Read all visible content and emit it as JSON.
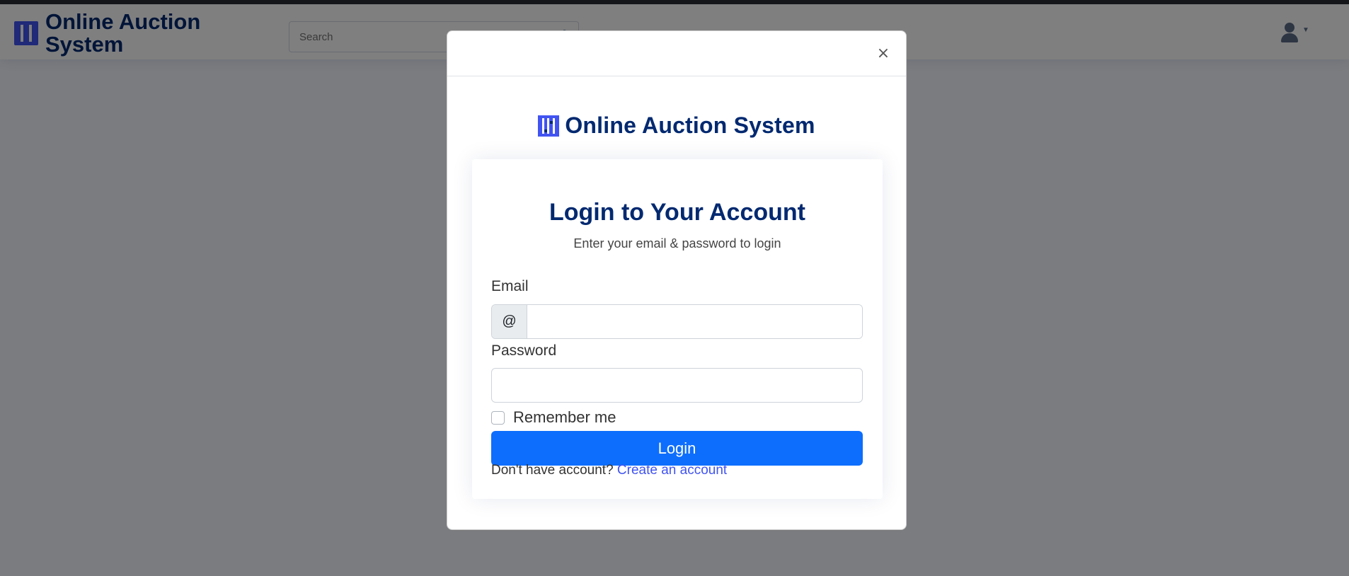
{
  "background": {
    "brand": "Online Auction System",
    "search": {
      "placeholder": "Search"
    },
    "icons": {
      "search": "search-icon",
      "profile": "user-icon",
      "dropdown": "caret-down-icon"
    }
  },
  "modal": {
    "close_icon": "close-icon",
    "brand": "Online Auction System",
    "title": "Login to Your Account",
    "subtitle": "Enter your email & password to login",
    "email": {
      "label": "Email",
      "prefix": "@",
      "value": "",
      "placeholder": ""
    },
    "password": {
      "label": "Password",
      "value": "",
      "placeholder": ""
    },
    "remember": {
      "label": "Remember me",
      "checked": false
    },
    "login_label": "Login",
    "signup": {
      "prompt": "Don't have account?",
      "link": "Create an account"
    }
  },
  "colors": {
    "brand_navy": "#012970",
    "brand_blue": "#4154f1",
    "primary_button": "#0d6efd",
    "backdrop": "rgba(0,0,0,0.5)"
  }
}
